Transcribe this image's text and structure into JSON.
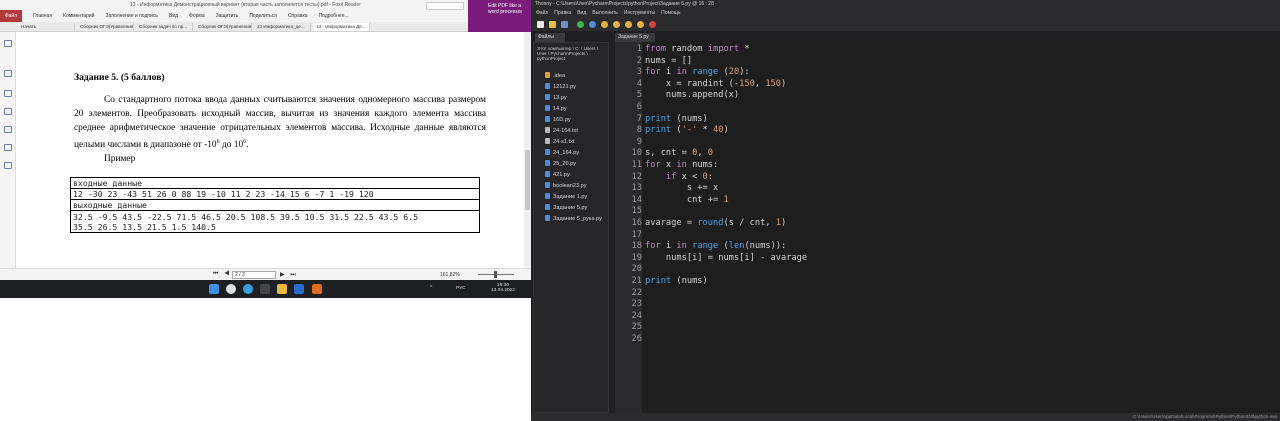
{
  "pdf_reader": {
    "title": "13 - Информатика Демонстрационный вариант (вторая часть заполняется тесты).pdf - Foxit Reader",
    "menu": [
      "Файл",
      "Главная",
      "Комментарий",
      "Заполнение и подпись",
      "Вид",
      "Форма",
      "Защитить",
      "Поделиться",
      "Справка",
      "Подробнее..."
    ],
    "promo": "Edit PDF like a word processor",
    "tabs": [
      {
        "label": "Начать",
        "active": false
      },
      {
        "label": "Сборник ОГЭ(Уравнения)...",
        "active": false
      },
      {
        "label": "Сборник задач по пр...",
        "active": false
      },
      {
        "label": "Сборник ОГЭ(Уравнения)...",
        "active": false
      },
      {
        "label": "13 Информатика_де...",
        "active": false
      },
      {
        "label": "13 - Информатика Де...",
        "active": true
      }
    ],
    "task_heading": "Задание 5. (5 баллов)",
    "task_text_1": "Со стандартного потока ввода данных считываются значения одномерного массива размером 20 элементов. Преобразовать исходный массив, вычитая из значения каждого элемента массива среднее арифметическое значение отрицательных элементов массива. Исходные данные являются целыми числами в диапазоне от -10",
    "task_sup_1": "6",
    "task_text_2": " до 10",
    "task_sup_2": "6",
    "task_text_3": ".",
    "example_label": "Пример",
    "io_table": {
      "input_header": "входные данные",
      "input_value": "12 -30 23 -43 51 26 0 88 19 -10 11 2 23 -14 15 6 -7 1 -19 120",
      "output_header": "выходные данные",
      "output_line_1": "32.5 -9.5 43.5 -22.5 71.5 46.5 20.5 108.5 39.5 10.5 31.5 22.5 43.5 6.5",
      "output_line_2": "35.5 26.5 13.5 21.5 1.5 140.5"
    },
    "status": {
      "page": "2 / 3",
      "zoom": "161,82%"
    }
  },
  "taskbar": {
    "lang": "РУС",
    "time": "18:30",
    "date": "13.04.2022"
  },
  "thonny": {
    "title": "Thonny  -  C:\\Users\\User\\PycharmProjects\\pythonProject\\Задание 5.py  @  16 : 28",
    "menu": [
      "Файл",
      "Правка",
      "Вид",
      "Выполнить",
      "Инструменты",
      "Помощь"
    ],
    "files_tab": "Файлы",
    "files_path": "Этот компьютер \\ C: \\ Users \\ User \\ PycharmProjects \\ pythonProject",
    "files": [
      {
        "name": ".idea",
        "type": "folder"
      },
      {
        "name": "12121.py",
        "type": "py"
      },
      {
        "name": "13.py",
        "type": "py"
      },
      {
        "name": "14.py",
        "type": "py"
      },
      {
        "name": "16D.py",
        "type": "py"
      },
      {
        "name": "24-164.txt",
        "type": "txt"
      },
      {
        "name": "24-s1.txt",
        "type": "txt"
      },
      {
        "name": "24_164.py",
        "type": "py"
      },
      {
        "name": "25_20.py",
        "type": "py"
      },
      {
        "name": "421.py",
        "type": "py"
      },
      {
        "name": "boolean23.py",
        "type": "py"
      },
      {
        "name": "Задание 1.py",
        "type": "py"
      },
      {
        "name": "Задание 5.py",
        "type": "py"
      },
      {
        "name": "Задание 5_рука.py",
        "type": "py"
      }
    ],
    "editor_tab": "Задание 5.py",
    "code_lines": [
      [
        {
          "t": "from",
          "c": "kw"
        },
        {
          "t": " random "
        },
        {
          "t": "import",
          "c": "kw"
        },
        {
          "t": " *"
        }
      ],
      [
        {
          "t": "nums = []"
        }
      ],
      [
        {
          "t": "for",
          "c": "kw"
        },
        {
          "t": " i "
        },
        {
          "t": "in",
          "c": "kw"
        },
        {
          "t": " "
        },
        {
          "t": "range",
          "c": "bi"
        },
        {
          "t": " ("
        },
        {
          "t": "20",
          "c": "num"
        },
        {
          "t": "):"
        }
      ],
      [
        {
          "t": "    x = randint (-"
        },
        {
          "t": "150",
          "c": "num"
        },
        {
          "t": ", "
        },
        {
          "t": "150",
          "c": "num"
        },
        {
          "t": ")"
        }
      ],
      [
        {
          "t": "    nums.append(x)"
        }
      ],
      [],
      [
        {
          "t": "print",
          "c": "bi"
        },
        {
          "t": " (nums)"
        }
      ],
      [
        {
          "t": "print",
          "c": "bi"
        },
        {
          "t": " ("
        },
        {
          "t": "'-'",
          "c": "str"
        },
        {
          "t": " * "
        },
        {
          "t": "40",
          "c": "num"
        },
        {
          "t": ")"
        }
      ],
      [],
      [
        {
          "t": "s, cnt = "
        },
        {
          "t": "0",
          "c": "num"
        },
        {
          "t": ", "
        },
        {
          "t": "0",
          "c": "num"
        }
      ],
      [
        {
          "t": "for",
          "c": "kw"
        },
        {
          "t": " x "
        },
        {
          "t": "in",
          "c": "kw"
        },
        {
          "t": " nums:"
        }
      ],
      [
        {
          "t": "    "
        },
        {
          "t": "if",
          "c": "kw"
        },
        {
          "t": " x < "
        },
        {
          "t": "0",
          "c": "num"
        },
        {
          "t": ":"
        }
      ],
      [
        {
          "t": "        s += x"
        }
      ],
      [
        {
          "t": "        cnt += "
        },
        {
          "t": "1",
          "c": "num"
        }
      ],
      [],
      [
        {
          "t": "avarage = "
        },
        {
          "t": "round",
          "c": "bi"
        },
        {
          "t": "(s / cnt, "
        },
        {
          "t": "1",
          "c": "num"
        },
        {
          "t": ")"
        }
      ],
      [],
      [
        {
          "t": "for",
          "c": "kw"
        },
        {
          "t": " i "
        },
        {
          "t": "in",
          "c": "kw"
        },
        {
          "t": " "
        },
        {
          "t": "range",
          "c": "bi"
        },
        {
          "t": " ("
        },
        {
          "t": "len",
          "c": "bi"
        },
        {
          "t": "(nums)):"
        }
      ],
      [
        {
          "t": "    nums[i] = nums[i] - avarage"
        }
      ],
      [],
      [
        {
          "t": "print",
          "c": "bi"
        },
        {
          "t": " (nums)"
        }
      ],
      [],
      [],
      [],
      [],
      []
    ],
    "status": "C:\\Users\\User\\AppData\\Local\\Programs\\Python\\Python310\\python.exe"
  },
  "colors": {
    "pdf_file_menu": "#b23a3a",
    "promo": "#7a1d7a",
    "keyword": "#c586c0",
    "builtin": "#4fa3e0",
    "number": "#e0a170"
  }
}
